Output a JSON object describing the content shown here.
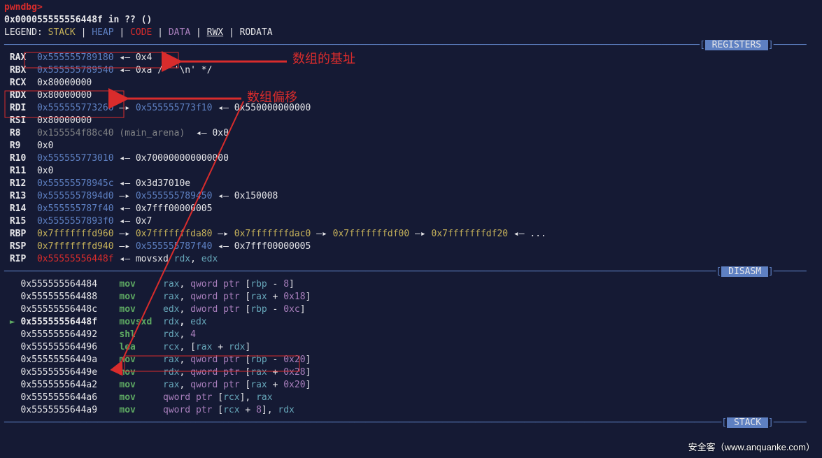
{
  "header": {
    "prompt": "pwndbg>",
    "addr_line": "0x000055555556448f in ?? ()",
    "legend_label": "LEGEND:",
    "legend_items": {
      "stack": "STACK",
      "heap": "HEAP",
      "code": "CODE",
      "data": "DATA",
      "rwx": "RWX",
      "rodata": "RODATA"
    }
  },
  "sections": {
    "registers": "REGISTERS",
    "disasm": "DISASM",
    "stack": "STACK"
  },
  "registers": [
    {
      "name": "RAX",
      "val": "0x555555789180",
      "cls": "c-blue",
      "chain": [
        {
          "t": "◂— ",
          "cls": "c-white"
        },
        {
          "t": "0x4",
          "cls": "c-white"
        }
      ]
    },
    {
      "name": "RBX",
      "val": "0x555555789540",
      "cls": "c-blue",
      "chain": [
        {
          "t": "◂— ",
          "cls": "c-white"
        },
        {
          "t": "0xa /* '\\n' */",
          "cls": "c-white"
        }
      ]
    },
    {
      "name": "RCX",
      "val": "0x80000000",
      "cls": "c-white"
    },
    {
      "name": "RDX",
      "val": "0x80000000",
      "cls": "c-white"
    },
    {
      "name": "RDI",
      "val": "0x555555773260",
      "cls": "c-blue",
      "chain": [
        {
          "t": "—▸ ",
          "cls": "c-white"
        },
        {
          "t": "0x555555773f10",
          "cls": "c-blue"
        },
        {
          "t": " ◂— ",
          "cls": "c-white"
        },
        {
          "t": "0x550000000000",
          "cls": "c-white"
        }
      ]
    },
    {
      "name": "RSI",
      "val": "0x80000000",
      "cls": "c-white"
    },
    {
      "name": "R8 ",
      "val": "0x155554f88c40",
      "cls": "c-grey",
      "suffix": " (main_arena)",
      "chain": [
        {
          "t": " ◂— ",
          "cls": "c-white"
        },
        {
          "t": "0x0",
          "cls": "c-white"
        }
      ]
    },
    {
      "name": "R9 ",
      "val": "0x0",
      "cls": "c-white"
    },
    {
      "name": "R10",
      "val": "0x555555773010",
      "cls": "c-blue",
      "chain": [
        {
          "t": "◂— ",
          "cls": "c-white"
        },
        {
          "t": "0x700000000000000",
          "cls": "c-white"
        }
      ]
    },
    {
      "name": "R11",
      "val": "0x0",
      "cls": "c-white"
    },
    {
      "name": "R12",
      "val": "0x55555578945c",
      "cls": "c-blue",
      "chain": [
        {
          "t": "◂— ",
          "cls": "c-white"
        },
        {
          "t": "0x3d37010e",
          "cls": "c-white"
        }
      ]
    },
    {
      "name": "R13",
      "val": "0x5555557894d0",
      "cls": "c-blue",
      "chain": [
        {
          "t": "—▸ ",
          "cls": "c-white"
        },
        {
          "t": "0x555555789450",
          "cls": "c-blue"
        },
        {
          "t": " ◂— ",
          "cls": "c-white"
        },
        {
          "t": "0x150008",
          "cls": "c-white"
        }
      ]
    },
    {
      "name": "R14",
      "val": "0x555555787f40",
      "cls": "c-blue",
      "chain": [
        {
          "t": "◂— ",
          "cls": "c-white"
        },
        {
          "t": "0x7fff00000005",
          "cls": "c-white"
        }
      ]
    },
    {
      "name": "R15",
      "val": "0x5555557893f0",
      "cls": "c-blue",
      "chain": [
        {
          "t": "◂— ",
          "cls": "c-white"
        },
        {
          "t": "0x7",
          "cls": "c-white"
        }
      ]
    },
    {
      "name": "RBP",
      "val": "0x7fffffffd960",
      "cls": "c-yellow",
      "chain": [
        {
          "t": "—▸ ",
          "cls": "c-white"
        },
        {
          "t": "0x7fffffffda80",
          "cls": "c-yellow"
        },
        {
          "t": " —▸ ",
          "cls": "c-white"
        },
        {
          "t": "0x7fffffffdac0",
          "cls": "c-yellow"
        },
        {
          "t": " —▸ ",
          "cls": "c-white"
        },
        {
          "t": "0x7fffffffdf00",
          "cls": "c-yellow"
        },
        {
          "t": " —▸ ",
          "cls": "c-white"
        },
        {
          "t": "0x7fffffffdf20",
          "cls": "c-yellow"
        },
        {
          "t": " ◂— ...",
          "cls": "c-white"
        }
      ]
    },
    {
      "name": "RSP",
      "val": "0x7fffffffd940",
      "cls": "c-yellow",
      "chain": [
        {
          "t": "—▸ ",
          "cls": "c-white"
        },
        {
          "t": "0x555555787f40",
          "cls": "c-blue"
        },
        {
          "t": " ◂— ",
          "cls": "c-white"
        },
        {
          "t": "0x7fff00000005",
          "cls": "c-white"
        }
      ]
    },
    {
      "name": "RIP",
      "val": "0x55555556448f",
      "cls": "c-red2",
      "chain": [
        {
          "t": "◂— ",
          "cls": "c-white"
        },
        {
          "t": "movsxd ",
          "cls": "c-white"
        },
        {
          "t": "rdx",
          "cls": "c-cyan"
        },
        {
          "t": ", ",
          "cls": "c-white"
        },
        {
          "t": "edx",
          "cls": "c-cyan"
        }
      ]
    }
  ],
  "disasm": [
    {
      "cur": false,
      "addr": "0x555555564484",
      "op": "mov   ",
      "args": [
        {
          "t": "rax",
          "cls": "c-cyan"
        },
        {
          "t": ", ",
          "cls": "c-white"
        },
        {
          "t": "qword ptr ",
          "cls": "c-purple"
        },
        {
          "t": "[",
          "cls": "c-white"
        },
        {
          "t": "rbp",
          "cls": "c-cyan"
        },
        {
          "t": " - ",
          "cls": "c-white"
        },
        {
          "t": "8",
          "cls": "c-purple"
        },
        {
          "t": "]",
          "cls": "c-white"
        }
      ]
    },
    {
      "cur": false,
      "addr": "0x555555564488",
      "op": "mov   ",
      "args": [
        {
          "t": "rax",
          "cls": "c-cyan"
        },
        {
          "t": ", ",
          "cls": "c-white"
        },
        {
          "t": "qword ptr ",
          "cls": "c-purple"
        },
        {
          "t": "[",
          "cls": "c-white"
        },
        {
          "t": "rax",
          "cls": "c-cyan"
        },
        {
          "t": " + ",
          "cls": "c-white"
        },
        {
          "t": "0x18",
          "cls": "c-purple"
        },
        {
          "t": "]",
          "cls": "c-white"
        }
      ]
    },
    {
      "cur": false,
      "addr": "0x55555556448c",
      "op": "mov   ",
      "args": [
        {
          "t": "edx",
          "cls": "c-cyan"
        },
        {
          "t": ", ",
          "cls": "c-white"
        },
        {
          "t": "dword ptr ",
          "cls": "c-purple"
        },
        {
          "t": "[",
          "cls": "c-white"
        },
        {
          "t": "rbp",
          "cls": "c-cyan"
        },
        {
          "t": " - ",
          "cls": "c-white"
        },
        {
          "t": "0xc",
          "cls": "c-purple"
        },
        {
          "t": "]",
          "cls": "c-white"
        }
      ]
    },
    {
      "cur": true,
      "addr": "0x55555556448f",
      "op": "movsxd",
      "args": [
        {
          "t": "rdx",
          "cls": "c-cyan"
        },
        {
          "t": ", ",
          "cls": "c-white"
        },
        {
          "t": "edx",
          "cls": "c-cyan"
        }
      ]
    },
    {
      "cur": false,
      "addr": "0x555555564492",
      "op": "shl   ",
      "args": [
        {
          "t": "rdx",
          "cls": "c-cyan"
        },
        {
          "t": ", ",
          "cls": "c-white"
        },
        {
          "t": "4",
          "cls": "c-purple"
        }
      ]
    },
    {
      "cur": false,
      "addr": "0x555555564496",
      "op": "lea   ",
      "args": [
        {
          "t": "rcx",
          "cls": "c-cyan"
        },
        {
          "t": ", [",
          "cls": "c-white"
        },
        {
          "t": "rax",
          "cls": "c-cyan"
        },
        {
          "t": " + ",
          "cls": "c-white"
        },
        {
          "t": "rdx",
          "cls": "c-cyan"
        },
        {
          "t": "]",
          "cls": "c-white"
        }
      ]
    },
    {
      "cur": false,
      "addr": "0x55555556449a",
      "op": "mov   ",
      "args": [
        {
          "t": "rax",
          "cls": "c-cyan"
        },
        {
          "t": ", ",
          "cls": "c-white"
        },
        {
          "t": "qword ptr ",
          "cls": "c-purple"
        },
        {
          "t": "[",
          "cls": "c-white"
        },
        {
          "t": "rbp",
          "cls": "c-cyan"
        },
        {
          "t": " - ",
          "cls": "c-white"
        },
        {
          "t": "0x20",
          "cls": "c-purple"
        },
        {
          "t": "]",
          "cls": "c-white"
        }
      ]
    },
    {
      "cur": false,
      "addr": "0x55555556449e",
      "op": "mov   ",
      "args": [
        {
          "t": "rdx",
          "cls": "c-cyan"
        },
        {
          "t": ", ",
          "cls": "c-white"
        },
        {
          "t": "qword ptr ",
          "cls": "c-purple"
        },
        {
          "t": "[",
          "cls": "c-white"
        },
        {
          "t": "rax",
          "cls": "c-cyan"
        },
        {
          "t": " + ",
          "cls": "c-white"
        },
        {
          "t": "0x28",
          "cls": "c-purple"
        },
        {
          "t": "]",
          "cls": "c-white"
        }
      ]
    },
    {
      "cur": false,
      "addr": "0x5555555644a2",
      "op": "mov   ",
      "args": [
        {
          "t": "rax",
          "cls": "c-cyan"
        },
        {
          "t": ", ",
          "cls": "c-white"
        },
        {
          "t": "qword ptr ",
          "cls": "c-purple"
        },
        {
          "t": "[",
          "cls": "c-white"
        },
        {
          "t": "rax",
          "cls": "c-cyan"
        },
        {
          "t": " + ",
          "cls": "c-white"
        },
        {
          "t": "0x20",
          "cls": "c-purple"
        },
        {
          "t": "]",
          "cls": "c-white"
        }
      ]
    },
    {
      "cur": false,
      "addr": "0x5555555644a6",
      "op": "mov   ",
      "args": [
        {
          "t": "qword ptr ",
          "cls": "c-purple"
        },
        {
          "t": "[",
          "cls": "c-white"
        },
        {
          "t": "rcx",
          "cls": "c-cyan"
        },
        {
          "t": "], ",
          "cls": "c-white"
        },
        {
          "t": "rax",
          "cls": "c-cyan"
        }
      ]
    },
    {
      "cur": false,
      "addr": "0x5555555644a9",
      "op": "mov   ",
      "args": [
        {
          "t": "qword ptr ",
          "cls": "c-purple"
        },
        {
          "t": "[",
          "cls": "c-white"
        },
        {
          "t": "rcx",
          "cls": "c-cyan"
        },
        {
          "t": " + ",
          "cls": "c-white"
        },
        {
          "t": "8",
          "cls": "c-purple"
        },
        {
          "t": "], ",
          "cls": "c-white"
        },
        {
          "t": "rdx",
          "cls": "c-cyan"
        }
      ]
    }
  ],
  "annotations": {
    "base": "数组的基址",
    "offset": "数组偏移"
  },
  "watermark": "安全客（www.anquanke.com）"
}
